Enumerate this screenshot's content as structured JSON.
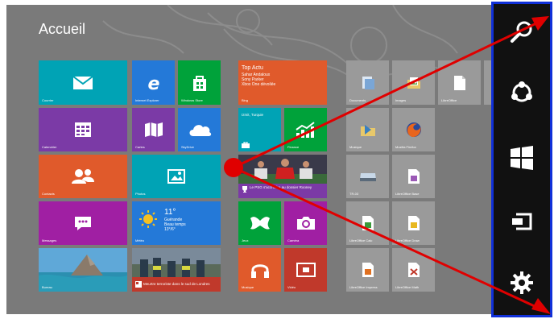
{
  "screen": {
    "title": "Accueil"
  },
  "tiles": {
    "mail": {
      "label": "Courrier",
      "color": "#00a3b5",
      "icon": "mail-icon"
    },
    "ie": {
      "label": "Internet Explorer",
      "color": "#2479d8",
      "icon": "internet-explorer-icon"
    },
    "store": {
      "label": "Windows Store",
      "color": "#00a23a",
      "icon": "store-icon"
    },
    "calendar": {
      "label": "Calendrier",
      "color": "#7b3aa6",
      "icon": "calendar-icon"
    },
    "maps": {
      "label": "Cartes",
      "color": "#7b3aa6",
      "icon": "maps-icon"
    },
    "skydrive": {
      "label": "SkyDrive",
      "color": "#2479d8",
      "icon": "cloud-icon"
    },
    "contacts": {
      "label": "Contacts",
      "color": "#e05a2b",
      "icon": "people-icon"
    },
    "photos": {
      "label": "Photos",
      "color": "#00a3b5",
      "icon": "photo-icon"
    },
    "messaging": {
      "label": "Messages",
      "color": "#a01fa3",
      "icon": "messaging-icon"
    },
    "weather": {
      "label": "Météo",
      "color": "#2479d8",
      "icon": "sun-icon",
      "temp": "11°",
      "city": "Guérande",
      "condition": "Beau temps",
      "range": "13°/6°"
    },
    "desktop": {
      "label": "Bureau",
      "color": "#3a7fc0"
    },
    "news": {
      "color": "#c0392b",
      "icon": "news-icon",
      "text": "Meurtre terroriste dans le sud de Londres"
    },
    "bing": {
      "label": "Bing",
      "color": "#e05a2b",
      "headline": "Top Actu",
      "lines": [
        "Sahar Andaloux",
        "Sony Parker",
        "Xbox One dévoilée"
      ]
    },
    "travel": {
      "label": "Izmit, Turquie",
      "color": "#00a3b5",
      "icon": "suitcase-icon"
    },
    "finance": {
      "label": "Finance",
      "color": "#00a23a",
      "icon": "chart-icon"
    },
    "sport": {
      "color": "#7b3aa6",
      "icon": "trophy-icon",
      "text": "Le PSG s'accroche au dossier Rooney"
    },
    "games": {
      "label": "Jeux",
      "color": "#00a23a",
      "icon": "gamepad-icon"
    },
    "camera": {
      "label": "Caméra",
      "color": "#a01fa3",
      "icon": "camera-icon"
    },
    "music": {
      "label": "Musique",
      "color": "#e05a2b",
      "icon": "headphones-icon"
    },
    "video": {
      "label": "Vidéo",
      "color": "#c0392b",
      "icon": "video-icon"
    }
  },
  "desktop_tiles": {
    "color": "#9a9a9a",
    "items": [
      {
        "label": "Documents",
        "icon": "documents-icon"
      },
      {
        "label": "Images",
        "icon": "images-icon"
      },
      {
        "label": "LibreOffice",
        "icon": "libreoffice-icon"
      },
      {
        "label": "Musique",
        "icon": "music-folder-icon"
      },
      {
        "label": "Mozilla Firefox",
        "icon": "firefox-icon"
      },
      {
        "label": "TR-03",
        "icon": "drive-icon"
      },
      {
        "label": "LibreOffice Base",
        "icon": "lo-base-icon"
      },
      {
        "label": "LibreOffice Calc",
        "icon": "lo-calc-icon"
      },
      {
        "label": "LibreOffice Draw",
        "icon": "lo-draw-icon"
      },
      {
        "label": "LibreOffice Impress",
        "icon": "lo-impress-icon"
      },
      {
        "label": "LibreOffice Math",
        "icon": "lo-math-icon"
      }
    ]
  },
  "charms": [
    {
      "name": "search",
      "icon": "search-icon"
    },
    {
      "name": "share",
      "icon": "share-icon"
    },
    {
      "name": "start",
      "icon": "windows-icon"
    },
    {
      "name": "devices",
      "icon": "devices-icon"
    },
    {
      "name": "settings",
      "icon": "gear-icon"
    }
  ],
  "annotation": {
    "arrow_color": "#e00000"
  }
}
